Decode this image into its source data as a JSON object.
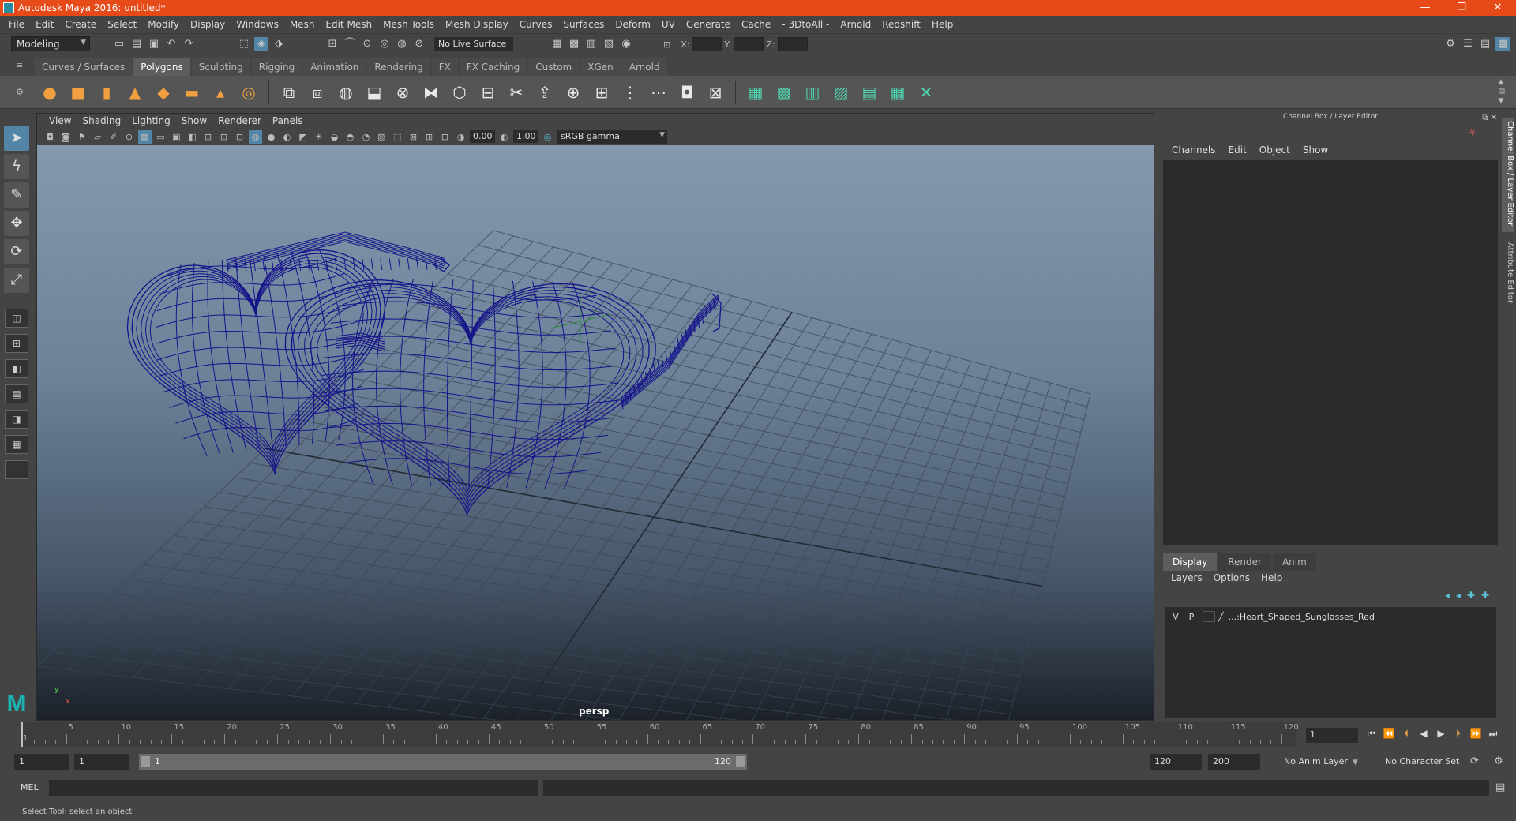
{
  "window": {
    "title": "Autodesk Maya 2016: untitled*",
    "controls": [
      "—",
      "❐",
      "✕"
    ]
  },
  "menubar": [
    "File",
    "Edit",
    "Create",
    "Select",
    "Modify",
    "Display",
    "Windows",
    "Mesh",
    "Edit Mesh",
    "Mesh Tools",
    "Mesh Display",
    "Curves",
    "Surfaces",
    "Deform",
    "UV",
    "Generate",
    "Cache",
    "- 3DtoAll -",
    "Arnold",
    "Redshift",
    "Help"
  ],
  "statusline": {
    "mode": "Modeling",
    "live_surface": "No Live Surface",
    "x_label": "X:",
    "y_label": "Y:",
    "z_label": "Z:"
  },
  "shelf": {
    "tabs": [
      "Curves / Surfaces",
      "Polygons",
      "Sculpting",
      "Rigging",
      "Animation",
      "Rendering",
      "FX",
      "FX Caching",
      "Custom",
      "XGen",
      "Arnold"
    ],
    "active_tab": "Polygons",
    "icons": [
      "poly-sphere-icon",
      "poly-cube-icon",
      "poly-cylinder-icon",
      "poly-cone-icon",
      "poly-torus-icon",
      "poly-plane-icon",
      "poly-pyramid-icon",
      "poly-pipe-icon",
      "combine-icon",
      "separate-icon",
      "smooth-icon",
      "extract-icon",
      "booleans-icon",
      "mirror-icon",
      "bevel-icon",
      "bridge-icon",
      "multi-cut-icon",
      "extrude-icon",
      "target-weld-icon",
      "append-icon",
      "insert-edge-loop-icon",
      "offset-edge-icon",
      "fill-hole-icon",
      "merge-icon",
      "planar-uv-icon",
      "auto-uv-icon",
      "cylindrical-uv-icon",
      "spherical-uv-icon",
      "uv-editor-icon",
      "checker-icon",
      "unfold-icon"
    ]
  },
  "viewport": {
    "menu": [
      "View",
      "Shading",
      "Lighting",
      "Show",
      "Renderer",
      "Panels"
    ],
    "exposure": "0.00",
    "gamma_value": "1.00",
    "color_space": "sRGB gamma",
    "camera": "persp",
    "axis_y": "y",
    "axis_x": "x"
  },
  "channel_box": {
    "title": "Channel Box / Layer Editor",
    "menu": [
      "Channels",
      "Edit",
      "Object",
      "Show"
    ]
  },
  "layer_editor": {
    "tabs": [
      "Display",
      "Render",
      "Anim"
    ],
    "active_tab": "Display",
    "menu": [
      "Layers",
      "Options",
      "Help"
    ],
    "layers": [
      {
        "v": "V",
        "p": "P",
        "name": "...:Heart_Shaped_Sunglasses_Red"
      }
    ]
  },
  "side_tabs": [
    "Channel Box / Layer Editor",
    "Attribute Editor"
  ],
  "timeline": {
    "ticks": [
      "5",
      "10",
      "15",
      "20",
      "25",
      "30",
      "35",
      "40",
      "45",
      "50",
      "55",
      "60",
      "65",
      "70",
      "75",
      "80",
      "85",
      "90",
      "95",
      "100",
      "105",
      "110",
      "115",
      "120"
    ],
    "start_label": "1",
    "current_frame": "1"
  },
  "range": {
    "start": "1",
    "anim_start": "1",
    "slider_low": "1",
    "slider_high": "120",
    "range_end": "120",
    "anim_end": "200",
    "anim_layer": "No Anim Layer",
    "character_set": "No Character Set"
  },
  "command_line": {
    "label": "MEL"
  },
  "help_line": {
    "text": "Select Tool: select an object"
  },
  "colors": {
    "titlebar": "#e64a19",
    "wireframe": "#1a1a8c",
    "accent": "#5285a6"
  }
}
